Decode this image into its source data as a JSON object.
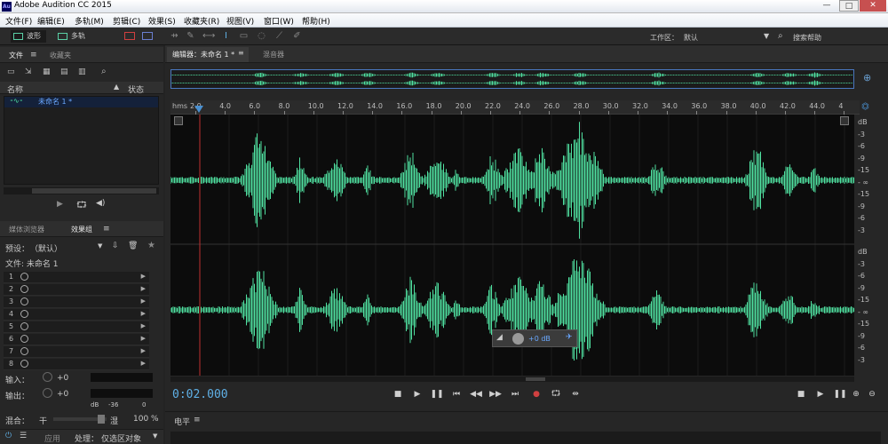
{
  "window": {
    "title": "Adobe Audition CC 2015",
    "icon": "Au"
  },
  "menu": [
    "文件(F)",
    "编辑(E)",
    "多轨(M)",
    "剪辑(C)",
    "效果(S)",
    "收藏夹(R)",
    "视图(V)",
    "窗口(W)",
    "帮助(H)"
  ],
  "modes": {
    "waveform": "波形",
    "multitrack": "多轨"
  },
  "workspace": {
    "label": "工作区：",
    "value": "默认",
    "search": "搜索帮助"
  },
  "files_panel": {
    "tabs": [
      "文件",
      "收藏夹"
    ],
    "col_name": "名称",
    "col_status": "状态",
    "file_name": "未命名 1 *"
  },
  "effects_panel": {
    "tabs": [
      "媒体浏览器",
      "效果组"
    ],
    "preset_label": "预设：",
    "preset_value": "（默认）",
    "file_label": "文件: 未命名 1",
    "slots": [
      "1",
      "2",
      "3",
      "4",
      "5",
      "6",
      "7",
      "8"
    ],
    "input_label": "输入：",
    "input_value": "+0",
    "output_label": "输出：",
    "output_value": "+0",
    "meter_ticks": [
      "dB",
      "-36",
      "0"
    ],
    "mix_label": "混合：",
    "mix_dry": "干",
    "mix_wet": "湿",
    "mix_value": "100 %",
    "apply_label": "应用",
    "process_label": "处理：",
    "process_value": "仅选区对象"
  },
  "editor": {
    "tab_editor": "编辑器：未命名 1 *",
    "tab_mixer": "混音器",
    "ruler_unit": "hms",
    "ruler_ticks": [
      "2.0",
      "4.0",
      "6.0",
      "8.0",
      "10.0",
      "12.0",
      "14.0",
      "16.0",
      "18.0",
      "20.0",
      "22.0",
      "24.0",
      "26.0",
      "28.0",
      "30.0",
      "32.0",
      "34.0",
      "36.0",
      "38.0",
      "40.0",
      "42.0",
      "44.0",
      "4"
    ],
    "db_scale": [
      "dB",
      "-3",
      "-6",
      "-9",
      "-15",
      "- ∞",
      "-15",
      "-9",
      "-6",
      "-3"
    ],
    "hud_gain": "+0 dB",
    "timecode": "0:02.000",
    "level_tab": "电平",
    "playhead_seconds": 2.0
  },
  "colors": {
    "waveform": "#4fe0a0",
    "playhead": "#c03030",
    "selection": "#4a78c0",
    "timecode": "#5fb0e6"
  }
}
